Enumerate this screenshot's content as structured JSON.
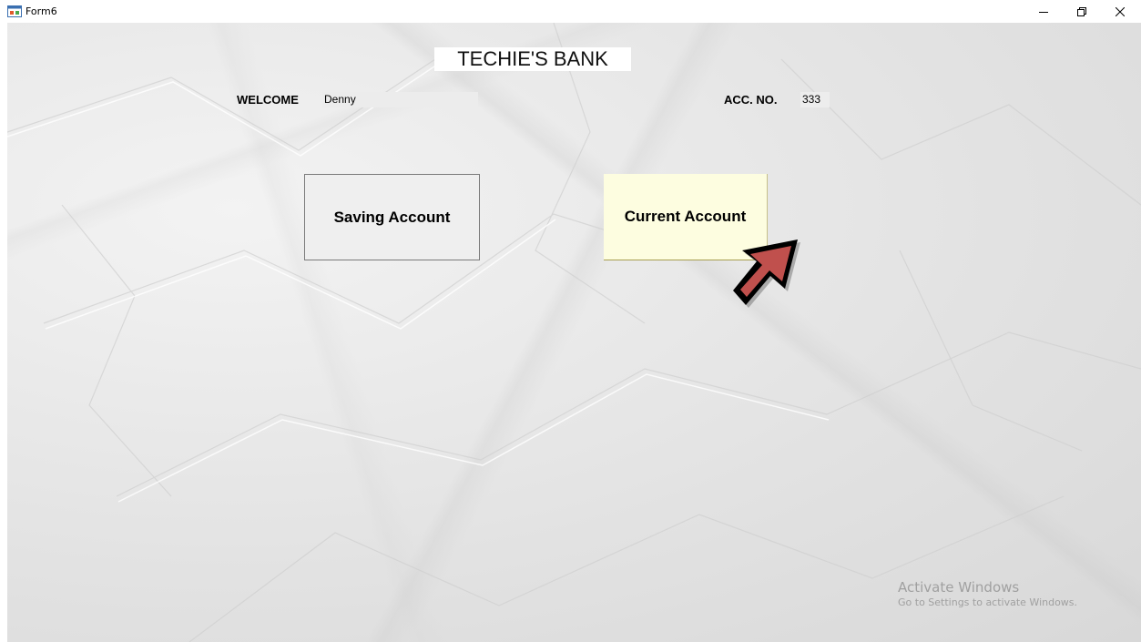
{
  "window": {
    "title": "Form6"
  },
  "form": {
    "bank_title": "TECHIE'S BANK",
    "welcome_label": "WELCOME",
    "customer_name": "Denny",
    "account_label": "ACC. NO.",
    "account_number": "333"
  },
  "buttons": {
    "saving_label": "Saving Account",
    "current_label": "Current Account"
  },
  "watermark": {
    "title": "Activate Windows",
    "subtitle": "Go to Settings to activate Windows."
  },
  "icons": {
    "app": "form-window-icon",
    "minimize": "minimize-icon",
    "restore": "restore-icon",
    "close": "close-icon",
    "pointer": "arrow-pointer-icon"
  },
  "colors": {
    "current_button_bg": "#fdfde0",
    "saving_button_bg": "#efefef",
    "arrow_fill": "#c0504d"
  }
}
